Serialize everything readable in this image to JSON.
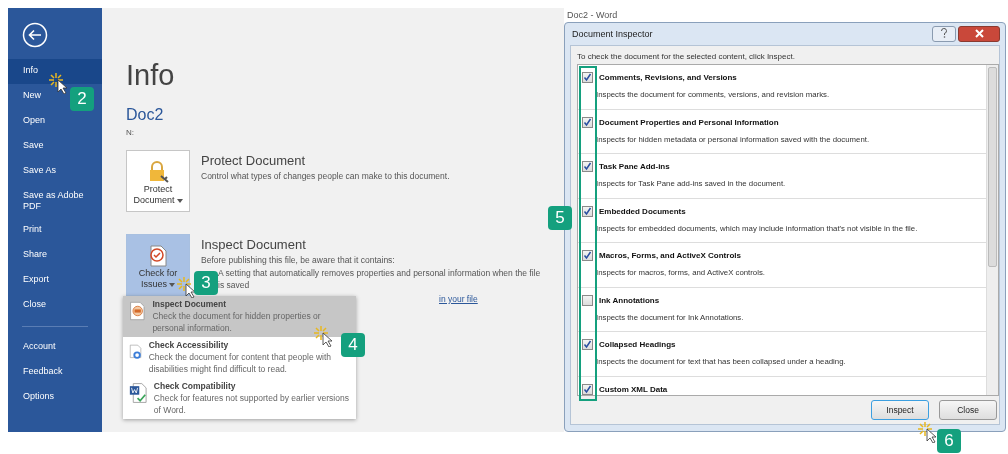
{
  "sidebar": {
    "items": [
      {
        "label": "Info",
        "selected": true
      },
      {
        "label": "New",
        "selected": false
      },
      {
        "label": "Open",
        "selected": false
      },
      {
        "label": "Save",
        "selected": false
      },
      {
        "label": "Save As",
        "selected": false
      },
      {
        "label": "Save as Adobe PDF",
        "selected": false
      },
      {
        "label": "Print",
        "selected": false
      },
      {
        "label": "Share",
        "selected": false
      },
      {
        "label": "Export",
        "selected": false
      },
      {
        "label": "Close",
        "selected": false
      }
    ],
    "bottom_items": [
      {
        "label": "Account",
        "selected": false
      },
      {
        "label": "Feedback",
        "selected": false
      },
      {
        "label": "Options",
        "selected": false
      }
    ]
  },
  "info": {
    "title": "Info",
    "document_name": "Doc2",
    "path": "N:",
    "sections": [
      {
        "button_label": "Protect Document",
        "selected": false,
        "heading": "Protect Document",
        "description": "Control what types of changes people can make to this document."
      },
      {
        "button_label": "Check for Issues",
        "selected": true,
        "heading": "Inspect Document",
        "description": "Before publishing this file, be aware that it contains:",
        "bullet": "A setting that automatically removes properties and personal information when the file is saved",
        "link": "in your file"
      }
    ]
  },
  "issues_menu": [
    {
      "title": "Inspect Document",
      "description": "Check the document for hidden properties or personal information.",
      "selected": true
    },
    {
      "title": "Check Accessibility",
      "description": "Check the document for content that people with disabilities might find difficult to read.",
      "selected": false
    },
    {
      "title": "Check Compatibility",
      "description": "Check for features not supported by earlier versions of Word.",
      "selected": false
    }
  ],
  "window_caption": "Doc2  -  Word",
  "dialog": {
    "title": "Document Inspector",
    "instruction": "To check the document for the selected content, click Inspect.",
    "items": [
      {
        "title": "Comments, Revisions, and Versions",
        "description": "Inspects the document for comments, versions, and revision marks.",
        "checked": true
      },
      {
        "title": "Document Properties and Personal Information",
        "description": "Inspects for hidden metadata or personal information saved with the document.",
        "checked": true
      },
      {
        "title": "Task Pane Add-ins",
        "description": "Inspects for Task Pane add-ins saved in the document.",
        "checked": true
      },
      {
        "title": "Embedded Documents",
        "description": "Inspects for embedded documents, which may include information that's not visible in the file.",
        "checked": true
      },
      {
        "title": "Macros, Forms, and ActiveX Controls",
        "description": "Inspects for macros, forms, and ActiveX controls.",
        "checked": true
      },
      {
        "title": "Ink Annotations",
        "description": "Inspects the document for Ink Annotations.",
        "checked": false
      },
      {
        "title": "Collapsed Headings",
        "description": "Inspects the document for text that has been collapsed under a heading.",
        "checked": true
      },
      {
        "title": "Custom XML Data",
        "checked": true
      }
    ],
    "buttons": [
      {
        "label": "Inspect",
        "default": true
      },
      {
        "label": "Close",
        "default": false
      }
    ]
  },
  "callouts": [
    "2",
    "3",
    "4",
    "5",
    "6"
  ]
}
